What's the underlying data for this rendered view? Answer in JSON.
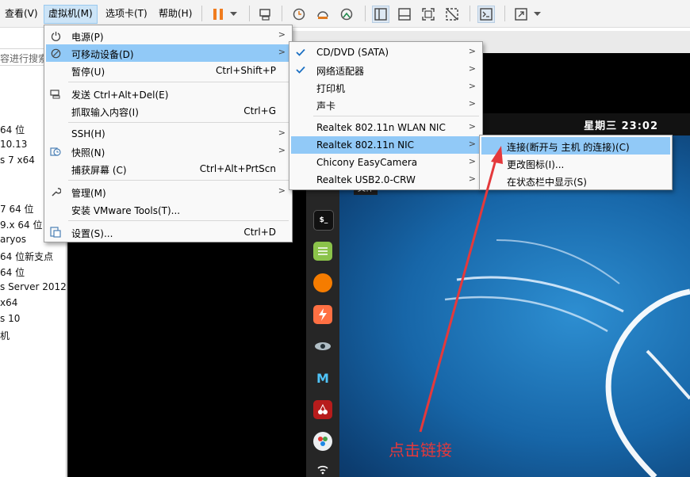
{
  "menubar": [
    {
      "label": "查看(V)"
    },
    {
      "label": "虚拟机(M)"
    },
    {
      "label": "选项卡(T)"
    },
    {
      "label": "帮助(H)"
    }
  ],
  "library": {
    "search_placeholder": "容进行搜索",
    "items": [
      "64 位",
      "10.13",
      "s 7 x64",
      "7 64 位",
      "9.x 64 位",
      "aryos",
      "64 位新支点",
      "64 位",
      "s Server 2012",
      "x64",
      "s 10",
      "机"
    ]
  },
  "vm_menu": [
    {
      "icon": "power-icon",
      "label": "电源(P)",
      "shortcut": "",
      "submenu": true
    },
    {
      "icon": "usb-device-icon",
      "label": "可移动设备(D)",
      "shortcut": "",
      "submenu": true
    },
    {
      "icon": "",
      "label": "暂停(U)",
      "shortcut": "Ctrl+Shift+P",
      "submenu": false
    },
    {
      "icon": "keyboard-icon",
      "label": "发送 Ctrl+Alt+Del(E)",
      "shortcut": "",
      "submenu": false
    },
    {
      "icon": "",
      "label": "抓取输入内容(I)",
      "shortcut": "Ctrl+G",
      "submenu": false
    },
    {
      "icon": "",
      "label": "SSH(H)",
      "shortcut": "",
      "submenu": true
    },
    {
      "icon": "snapshot-icon",
      "label": "快照(N)",
      "shortcut": "",
      "submenu": true
    },
    {
      "icon": "",
      "label": "捕获屏幕 (C)",
      "shortcut": "Ctrl+Alt+PrtScn",
      "submenu": false
    },
    {
      "icon": "wrench-icon",
      "label": "管理(M)",
      "shortcut": "",
      "submenu": true
    },
    {
      "icon": "",
      "label": "安装 VMware Tools(T)...",
      "shortcut": "",
      "submenu": false
    },
    {
      "icon": "settings-icon",
      "label": "设置(S)...",
      "shortcut": "Ctrl+D",
      "submenu": false
    }
  ],
  "devices_menu": [
    {
      "label": "CD/DVD (SATA)",
      "checked": true
    },
    {
      "label": "网络适配器",
      "checked": true
    },
    {
      "label": "打印机",
      "checked": false
    },
    {
      "label": "声卡",
      "checked": false
    },
    {
      "label": "Realtek 802.11n WLAN NIC",
      "checked": false
    },
    {
      "label": "Realtek 802.11n NIC",
      "checked": false
    },
    {
      "label": "Chicony EasyCamera",
      "checked": false
    },
    {
      "label": "Realtek USB2.0-CRW",
      "checked": false
    }
  ],
  "nic_menu": [
    {
      "label": "连接(断开与 主机 的连接)(C)"
    },
    {
      "label": "更改图标(I)..."
    },
    {
      "label": "在状态栏中显示(S)"
    }
  ],
  "guest": {
    "clock": "星期三 23:02",
    "file_tag": "文件",
    "terminal_label": "$_"
  },
  "annotation": {
    "text": "点击链接",
    "color": "#e4393c"
  },
  "colors": {
    "highlight": "#91c9f7",
    "pause_icon": "#f07c1e"
  }
}
